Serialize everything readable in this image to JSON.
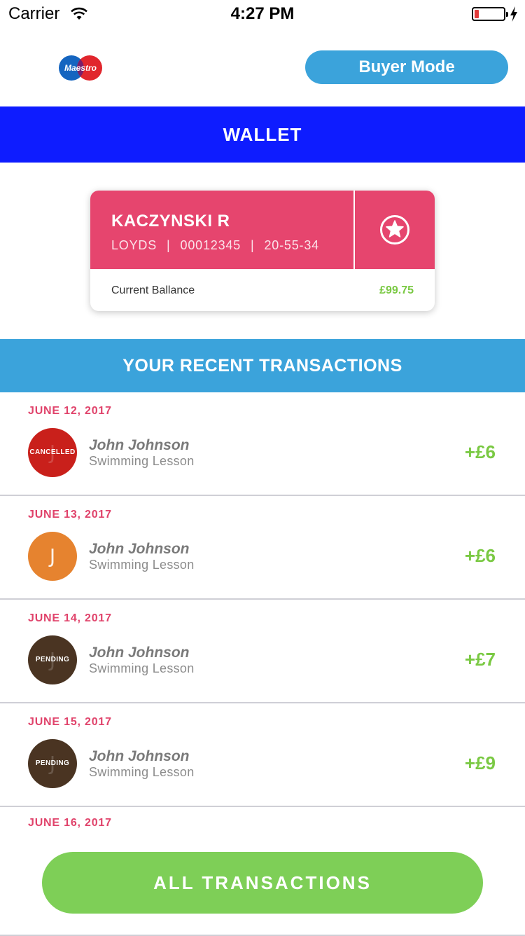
{
  "status_bar": {
    "carrier": "Carrier",
    "time": "4:27 PM"
  },
  "header": {
    "logo_text": "Maestro",
    "mode_button": "Buyer Mode"
  },
  "wallet_title": "WALLET",
  "card": {
    "holder": "KACZYNSKI R",
    "bank": "LOYDS",
    "account_number": "00012345",
    "sort_code": "20-55-34",
    "separator": "|",
    "balance_label": "Current Ballance",
    "balance_value": "£99.75",
    "color": "#e6456e"
  },
  "recent_title": "YOUR RECENT TRANSACTIONS",
  "transactions": [
    {
      "date": "JUNE 12, 2017",
      "initial": "J",
      "status": "CANCELLED",
      "avatar_color": "#c9201b",
      "name": "John Johnson",
      "description": "Swimming Lesson",
      "amount": "+£6"
    },
    {
      "date": "JUNE 13, 2017",
      "initial": "J",
      "status": "",
      "avatar_color": "#e6832f",
      "name": "John Johnson",
      "description": "Swimming Lesson",
      "amount": "+£6"
    },
    {
      "date": "JUNE 14, 2017",
      "initial": "J",
      "status": "PENDING",
      "avatar_color": "#4a3422",
      "name": "John Johnson",
      "description": "Swimming Lesson",
      "amount": "+£7"
    },
    {
      "date": "JUNE 15, 2017",
      "initial": "J",
      "status": "PENDING",
      "avatar_color": "#4a3422",
      "name": "John Johnson",
      "description": "Swimming Lesson",
      "amount": "+£9"
    }
  ],
  "next_date": "JUNE 16, 2017",
  "all_button": "ALL TRANSACTIONS",
  "colors": {
    "wallet_bar": "#0e1cff",
    "accent_blue": "#3ba3db",
    "pink": "#e0436b",
    "green": "#7ac943"
  }
}
